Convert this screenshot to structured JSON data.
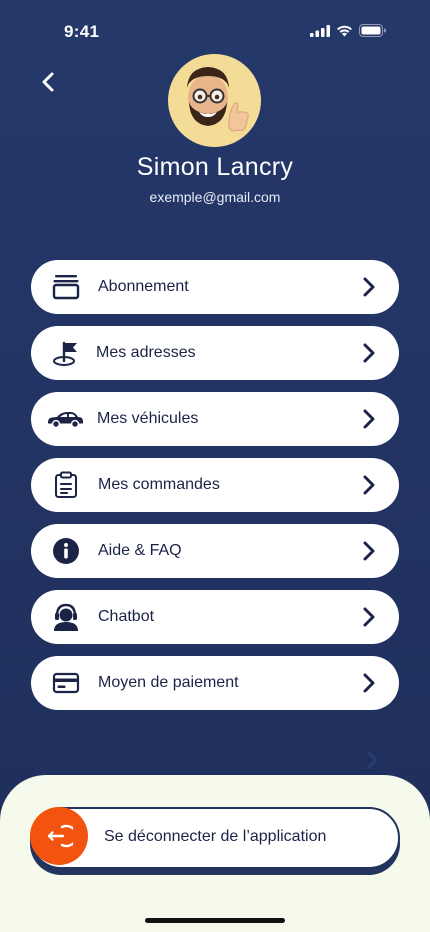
{
  "status_bar": {
    "time": "9:41"
  },
  "profile": {
    "name": "Simon Lancry",
    "email": "exemple@gmail.com"
  },
  "menu": {
    "items": [
      {
        "label": "Abonnement",
        "icon": "subscription-stack-icon"
      },
      {
        "label": "Mes adresses",
        "icon": "map-flag-icon"
      },
      {
        "label": "Mes véhicules",
        "icon": "car-icon"
      },
      {
        "label": "Mes commandes",
        "icon": "clipboard-icon"
      },
      {
        "label": "Aide & FAQ",
        "icon": "info-icon"
      },
      {
        "label": "Chatbot",
        "icon": "support-agent-icon"
      },
      {
        "label": "Moyen de paiement",
        "icon": "credit-card-icon"
      }
    ]
  },
  "logout": {
    "label": "Se déconnecter de l’application",
    "icon": "logout-icon"
  },
  "colors": {
    "background": "#223463",
    "accent": "#f2540f",
    "text_dark": "#1b2447",
    "sheet": "#f6faec",
    "avatar_bg": "#f3dc95"
  }
}
